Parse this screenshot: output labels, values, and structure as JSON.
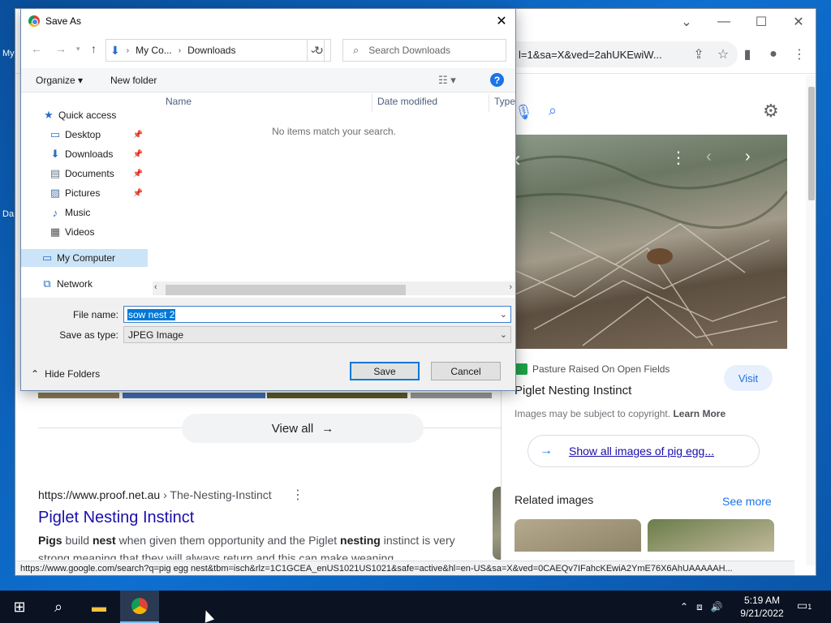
{
  "desktop": {
    "icon_labels": [
      "My",
      "Da"
    ]
  },
  "chrome": {
    "omnibox_text": "l=1&sa=X&ved=2ahUKEwiW...",
    "status_url": "https://www.google.com/search?q=pig egg nest&tbm=isch&rlz=1C1GCEA_enUS1021US1021&safe=active&hl=en-US&sa=X&ved=0CAEQv7IFahcKEwiA2YmE76X6AhUAAAAAH..."
  },
  "page": {
    "view_all_label": "View all",
    "result": {
      "domain": "https://www.proof.net.au",
      "path": " › The-Nesting-Instinct",
      "title": "Piglet Nesting Instinct",
      "snippet_parts": {
        "p1": "Pigs",
        "p2": " build ",
        "p3": "nest",
        "p4": " when given them opportunity and the Piglet ",
        "p5": "nesting",
        "p6": " instinct is very strong meaning that they will always return and this can make weaning ..."
      }
    }
  },
  "panel": {
    "source": "Pasture Raised On Open Fields",
    "visit_label": "Visit",
    "title": "Piglet Nesting Instinct",
    "copyright_text": "Images may be subject to copyright. ",
    "learn_more": "Learn More",
    "show_all_label": "Show all images of pig egg...",
    "related_label": "Related images",
    "see_more_label": "See more"
  },
  "dialog": {
    "title": "Save As",
    "address": {
      "crumb1": "My Co...",
      "crumb2": "Downloads"
    },
    "search_placeholder": "Search Downloads",
    "organize_label": "Organize ▾",
    "new_folder_label": "New folder",
    "nav": {
      "quick_access": "Quick access",
      "desktop": "Desktop",
      "downloads": "Downloads",
      "documents": "Documents",
      "pictures": "Pictures",
      "music": "Music",
      "videos": "Videos",
      "my_computer": "My Computer",
      "network": "Network"
    },
    "columns": {
      "name": "Name",
      "date": "Date modified",
      "type": "Type"
    },
    "empty_message": "No items match your search.",
    "file_name_label": "File name:",
    "file_name_value": "sow nest 2",
    "save_type_label": "Save as type:",
    "save_type_value": "JPEG Image",
    "save_label": "Save",
    "cancel_label": "Cancel",
    "hide_folders_label": "Hide Folders"
  },
  "taskbar": {
    "time": "5:19 AM",
    "date": "9/21/2022",
    "notification_count": "1"
  },
  "colors": {
    "accent": "#0078d7",
    "link": "#1a0dab",
    "google_blue": "#1a73e8"
  }
}
